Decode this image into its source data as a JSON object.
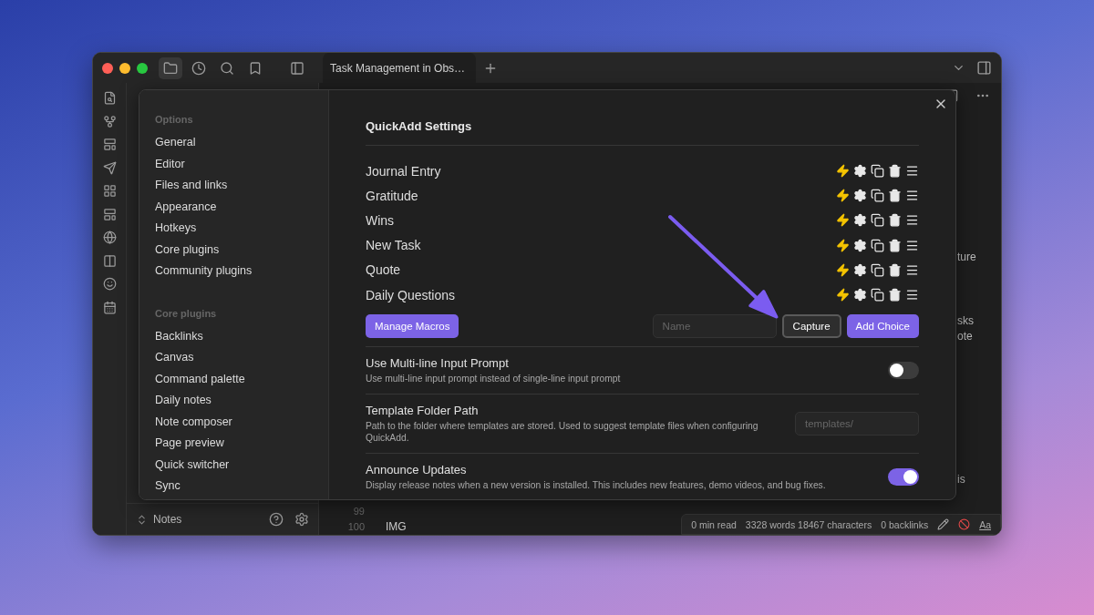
{
  "titlebar": {
    "nav_buttons": [
      {
        "selected": true
      },
      {
        "selected": false
      },
      {
        "selected": false
      },
      {
        "selected": false
      }
    ],
    "tabs": [
      {
        "label": "Task Management in Obs…",
        "selected": true
      }
    ]
  },
  "sidebar_footer": {
    "vault": "Notes"
  },
  "editor": {
    "fragments": [
      "ture",
      "sks",
      "ote",
      "is"
    ],
    "lines": [
      {
        "number": "99"
      },
      {
        "number": "100",
        "text": "IMG"
      }
    ]
  },
  "status_bar": {
    "items": [
      "0 min read",
      "3328 words 18467 characters",
      "0 backlinks"
    ],
    "mode": "Aa"
  },
  "settings_modal": {
    "nav_sections": [
      {
        "heading": "Options",
        "items": [
          {
            "label": "General",
            "selected": false
          },
          {
            "label": "Editor",
            "selected": false
          },
          {
            "label": "Files and links",
            "selected": false
          },
          {
            "label": "Appearance",
            "selected": false
          },
          {
            "label": "Hotkeys",
            "selected": false
          },
          {
            "label": "Core plugins",
            "selected": false
          },
          {
            "label": "Community plugins",
            "selected": false
          }
        ]
      },
      {
        "heading": "Core plugins",
        "items": [
          {
            "label": "Backlinks",
            "selected": false
          },
          {
            "label": "Canvas",
            "selected": false
          },
          {
            "label": "Command palette",
            "selected": false
          },
          {
            "label": "Daily notes",
            "selected": false
          },
          {
            "label": "Note composer",
            "selected": false
          },
          {
            "label": "Page preview",
            "selected": false
          },
          {
            "label": "Quick switcher",
            "selected": false
          },
          {
            "label": "Sync",
            "selected": false
          }
        ]
      }
    ],
    "title": "QuickAdd Settings",
    "choices": [
      {
        "name": "Journal Entry"
      },
      {
        "name": "Gratitude"
      },
      {
        "name": "Wins"
      },
      {
        "name": "New Task"
      },
      {
        "name": "Quote"
      },
      {
        "name": "Daily Questions"
      }
    ],
    "manage_button": "Manage Macros",
    "name_field": {
      "placeholder": "Name"
    },
    "type_select": "Capture",
    "add_button": "Add Choice",
    "settings": [
      {
        "kind": "toggle",
        "title": "Use Multi-line Input Prompt",
        "description": "Use multi-line input prompt instead of single-line input prompt",
        "on": false
      },
      {
        "kind": "text",
        "title": "Template Folder Path",
        "description": "Path to the folder where templates are stored. Used to suggest template files when configuring QuickAdd.",
        "placeholder": "templates/"
      },
      {
        "kind": "toggle",
        "title": "Announce Updates",
        "description": "Display release notes when a new version is installed. This includes new features, demo videos, and bug fixes.",
        "on": true
      }
    ]
  }
}
